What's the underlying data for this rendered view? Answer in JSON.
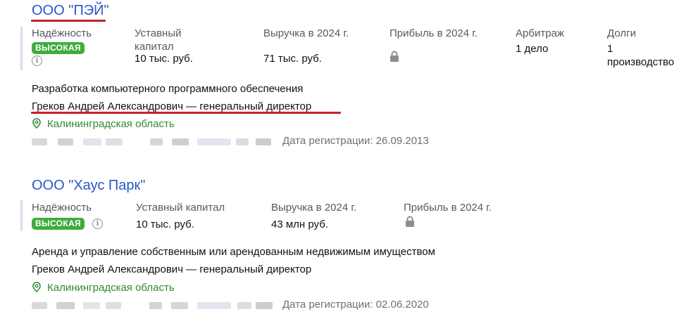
{
  "companies": [
    {
      "name": "ООО \"ПЭЙ\"",
      "reliability": {
        "label": "Надёжность",
        "badge": "ВЫСОКАЯ"
      },
      "capital": {
        "label": "Уставный капитал",
        "value": "10 тыс. руб."
      },
      "revenue": {
        "label": "Выручка в 2024 г.",
        "value": "71 тыс. руб."
      },
      "profit": {
        "label": "Прибыль в 2024 г.",
        "icon": "lock-icon"
      },
      "arbitration": {
        "label": "Арбитраж",
        "value": "1 дело"
      },
      "debts": {
        "label": "Долги",
        "value": "1 производство"
      },
      "activity": "Разработка компьютерного программного обеспечения",
      "director": "Греков Андрей Александрович — генеральный директор",
      "region": "Калининградская область",
      "registration": "Дата регистрации: 26.09.2013"
    },
    {
      "name": "ООО \"Хаус Парк\"",
      "reliability": {
        "label": "Надёжность",
        "badge": "ВЫСОКАЯ"
      },
      "capital": {
        "label": "Уставный капитал",
        "value": "10 тыс. руб."
      },
      "revenue": {
        "label": "Выручка в 2024 г.",
        "value": "43 млн руб."
      },
      "profit": {
        "label": "Прибыль в 2024 г.",
        "icon": "lock-icon"
      },
      "activity": "Аренда и управление собственным или арендованным недвижимым имуществом",
      "director": "Греков Андрей Александрович — генеральный директор",
      "region": "Калининградская область",
      "registration": "Дата регистрации: 02.06.2020"
    }
  ],
  "colors": {
    "link": "#2a57c9",
    "badge": "#3eac3d",
    "region": "#2f8a30",
    "annotation_underline": "#c3242b"
  }
}
